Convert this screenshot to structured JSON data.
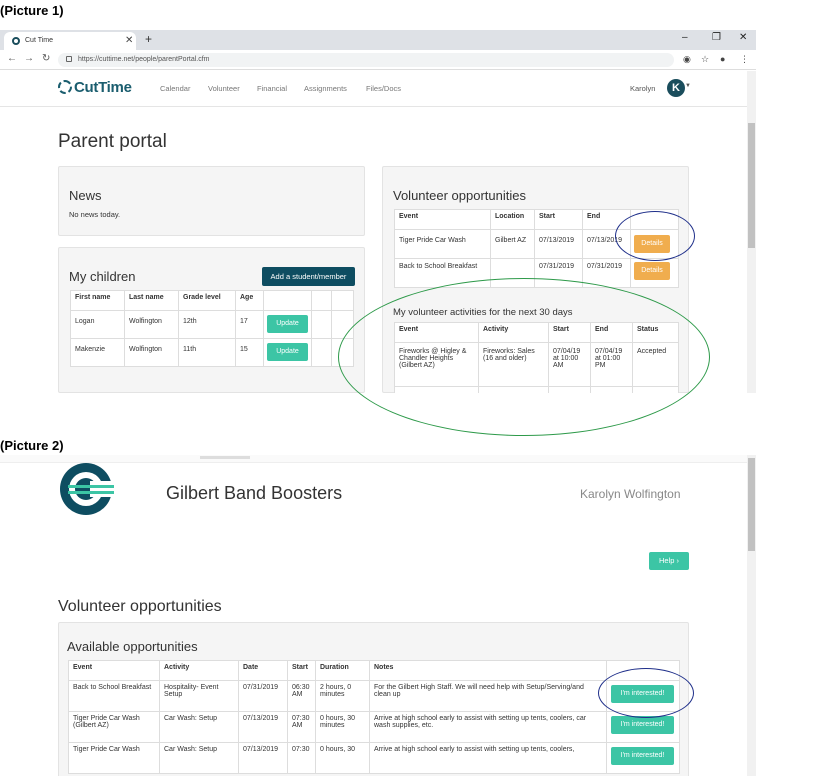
{
  "captions": {
    "picture1": "(Picture 1)",
    "picture2": "(Picture 2)"
  },
  "browser": {
    "tab_title": "Cut Time",
    "url": "https://cuttime.net/people/parentPortal.cfm"
  },
  "app_nav": {
    "logo": "CutTime",
    "links": [
      "Calendar",
      "Volunteer",
      "Financial",
      "Assignments",
      "Files/Docs"
    ],
    "user": "Karolyn",
    "avatar_letter": "K"
  },
  "portal": {
    "title": "Parent portal",
    "news": {
      "heading": "News",
      "text": "No news today."
    },
    "children": {
      "heading": "My children",
      "add_button": "Add a student/member",
      "columns": [
        "First name",
        "Last name",
        "Grade level",
        "Age"
      ],
      "rows": [
        {
          "first": "Logan",
          "last": "Wolfington",
          "grade": "12th",
          "age": "17",
          "action": "Update"
        },
        {
          "first": "Makenzie",
          "last": "Wolfington",
          "grade": "11th",
          "age": "15",
          "action": "Update"
        }
      ]
    },
    "volunteer": {
      "heading": "Volunteer opportunities",
      "columns": [
        "Event",
        "Location",
        "Start",
        "End"
      ],
      "rows": [
        {
          "event": "Tiger Pride Car Wash",
          "location": "Gilbert AZ",
          "start": "07/13/2019",
          "end": "07/13/2019",
          "action": "Details"
        },
        {
          "event": "Back to School Breakfast",
          "location": "",
          "start": "07/31/2019",
          "end": "07/31/2019",
          "action": "Details"
        }
      ]
    },
    "activities": {
      "heading": "My volunteer activities for the next 30 days",
      "columns": [
        "Event",
        "Activity",
        "Start",
        "End",
        "Status"
      ],
      "rows": [
        {
          "event": "Fireworks @ Higley & Chandler Heights (Gilbert AZ)",
          "activity": "Fireworks: Sales (16 and older)",
          "start": "07/04/19 at 10:00 AM",
          "end": "07/04/19 at 01:00 PM",
          "status": "Accepted"
        }
      ]
    }
  },
  "boosters": {
    "org_name": "Gilbert Band Boosters",
    "user": "Karolyn Wolfington",
    "help_button": "Help",
    "title": "Volunteer opportunities",
    "available": {
      "heading": "Available opportunities",
      "columns": [
        "Event",
        "Activity",
        "Date",
        "Start",
        "Duration",
        "Notes"
      ],
      "rows": [
        {
          "event": "Back to School Breakfast",
          "activity": "Hospitality- Event Setup",
          "date": "07/31/2019",
          "start": "06:30 AM",
          "duration": "2 hours, 0 minutes",
          "notes": "For the Gilbert High Staff. We will need help with Setup/Serving/and clean up",
          "action": "I'm interested!"
        },
        {
          "event": "Tiger Pride Car Wash (Gilbert AZ)",
          "activity": "Car Wash: Setup",
          "date": "07/13/2019",
          "start": "07:30 AM",
          "duration": "0 hours, 30 minutes",
          "notes": "Arrive at high school early to assist with setting up tents, coolers, car wash supplies, etc.",
          "action": "I'm interested!"
        },
        {
          "event": "Tiger Pride Car Wash",
          "activity": "Car Wash: Setup",
          "date": "07/13/2019",
          "start": "07:30",
          "duration": "0 hours, 30",
          "notes": "Arrive at high school early to assist with setting up tents, coolers,",
          "action": "I'm interested!"
        }
      ]
    }
  },
  "colors": {
    "accent_green": "#3cc5a5",
    "accent_orange": "#f0ad4e",
    "brand_dark": "#0e4d61",
    "oval_blue": "#1f2f8a",
    "oval_green": "#2e9a4a"
  }
}
